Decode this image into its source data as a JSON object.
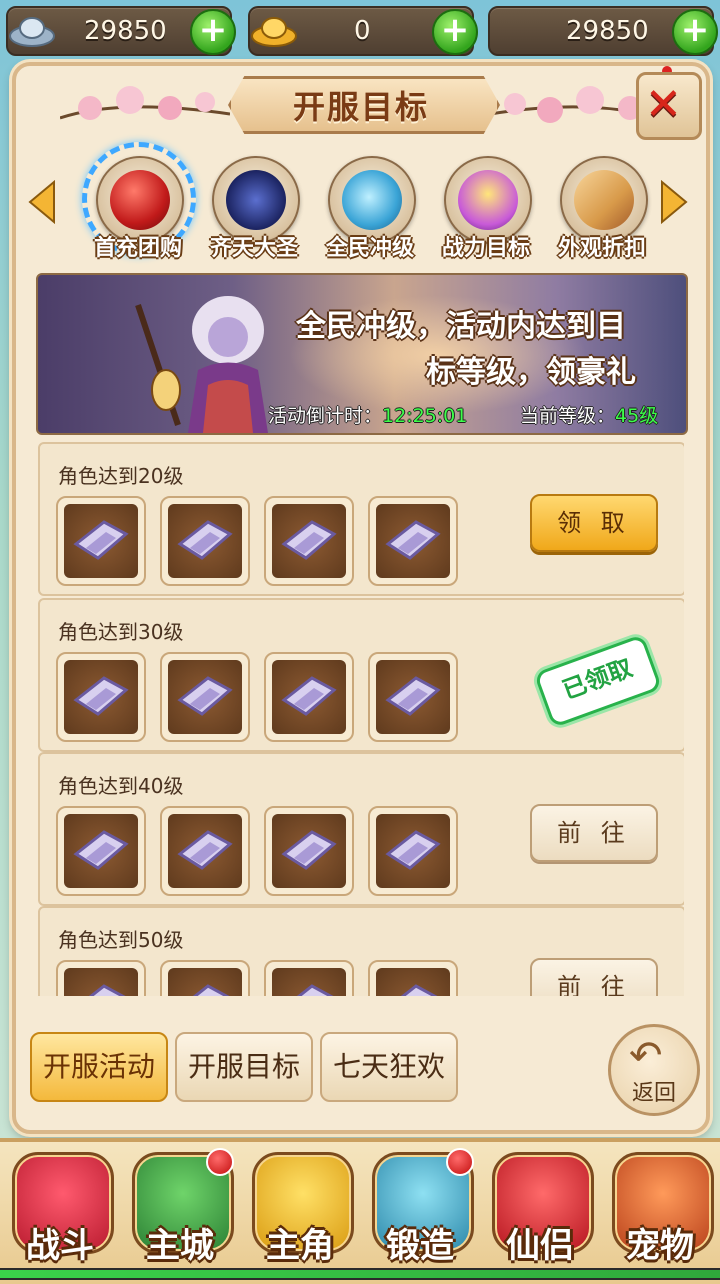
{
  "currency": {
    "silver": "29850",
    "gold": "0",
    "third": "29850",
    "icons": [
      "silver-ingot-icon",
      "gold-ingot-icon",
      "add-icon"
    ]
  },
  "panel": {
    "title": "开服目标",
    "close_icon": "close-icon"
  },
  "tabs": [
    {
      "label": "首充团购",
      "icon": "red-orb-icon",
      "selected": true
    },
    {
      "label": "齐天大圣",
      "icon": "constellation-icon",
      "selected": false
    },
    {
      "label": "全民冲级",
      "icon": "blue-bird-icon",
      "selected": false
    },
    {
      "label": "战力目标",
      "icon": "medal-icon",
      "selected": false
    },
    {
      "label": "外观折扣",
      "icon": "scroll-icon",
      "selected": false
    }
  ],
  "banner": {
    "line1": "全民冲级，活动内达到目",
    "line2": "标等级，领豪礼",
    "countdown_label": "活动倒计时：",
    "countdown_value": "12:25:01",
    "level_label": "当前等级：",
    "level_value": "45级"
  },
  "rows": [
    {
      "title": "角色达到20级",
      "action": "领 取",
      "state": "claim"
    },
    {
      "title": "角色达到30级",
      "action": "已领取",
      "state": "claimed"
    },
    {
      "title": "角色达到40级",
      "action": "前 往",
      "state": "goto"
    },
    {
      "title": "角色达到50级",
      "action": "前 往",
      "state": "goto"
    }
  ],
  "reward_icon": "talisman-scroll-icon",
  "bottom_tabs": [
    {
      "label": "开服活动",
      "active": true
    },
    {
      "label": "开服目标",
      "active": false
    },
    {
      "label": "七天狂欢",
      "active": false
    }
  ],
  "back": {
    "label": "返回",
    "icon": "back-arrow-icon"
  },
  "nav": [
    {
      "label": "战斗",
      "icon": "battle-icon",
      "badge": false,
      "color": "#e23a4e"
    },
    {
      "label": "主城",
      "icon": "city-icon",
      "badge": true,
      "color": "#3ea04a"
    },
    {
      "label": "主角",
      "icon": "hero-icon",
      "badge": false,
      "color": "#f1b62a"
    },
    {
      "label": "锻造",
      "icon": "hammer-icon",
      "badge": true,
      "color": "#3fa7c9"
    },
    {
      "label": "仙侣",
      "icon": "heart-icon",
      "badge": false,
      "color": "#d8262f"
    },
    {
      "label": "宠物",
      "icon": "monkey-icon",
      "badge": false,
      "color": "#d9501e"
    }
  ]
}
